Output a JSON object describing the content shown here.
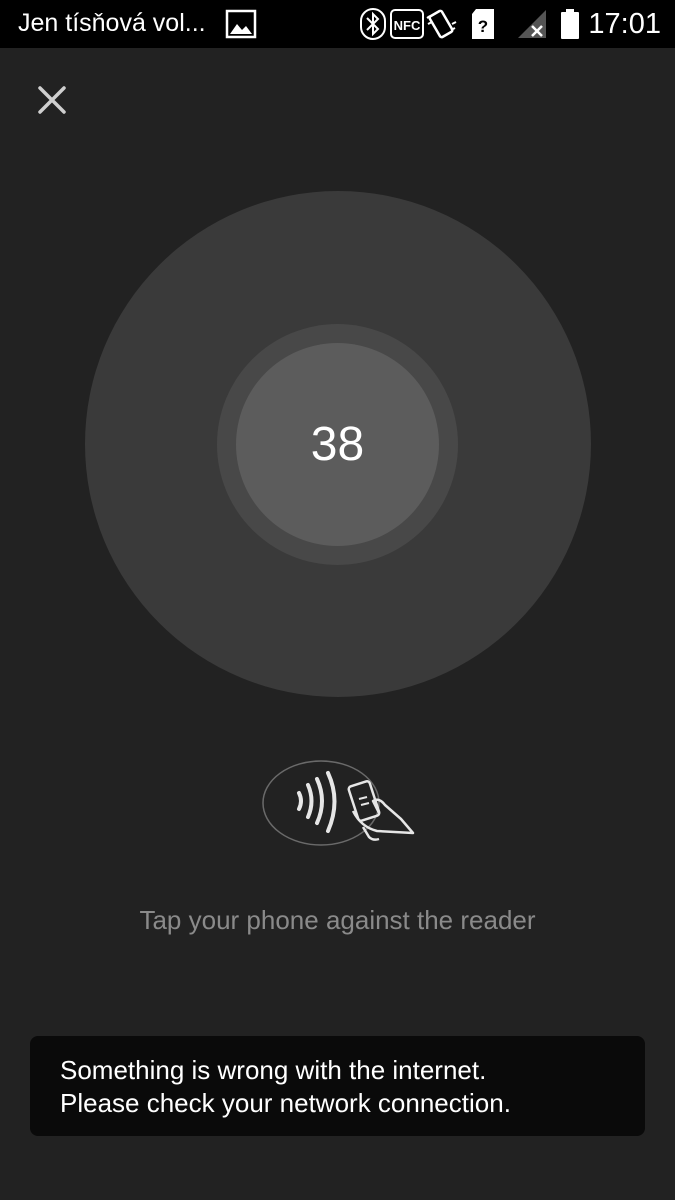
{
  "status_bar": {
    "title": "Jen tísňová vol...",
    "nfc_label": "NFC",
    "sim_label": "?",
    "time": "17:01",
    "icons": [
      "image-icon",
      "bluetooth-icon",
      "nfc-icon",
      "vibrate-icon",
      "sim-unknown-icon",
      "signal-no-service-icon",
      "battery-icon"
    ]
  },
  "close_icon": "close-icon",
  "payment": {
    "countdown": "38",
    "illustration_icon": "contactless-tap-icon",
    "instruction": "Tap your phone against the reader"
  },
  "toast": {
    "line1": "Something is wrong with the internet.",
    "line2": "Please check your network connection."
  },
  "colors": {
    "background": "#222222",
    "status_bar": "#000000",
    "outer_circle": "#3a3a3a",
    "ring": "#484848",
    "inner_circle": "#5c5c5c",
    "instruction_text": "#8a8a8a",
    "toast_background": "#0a0a0a"
  }
}
